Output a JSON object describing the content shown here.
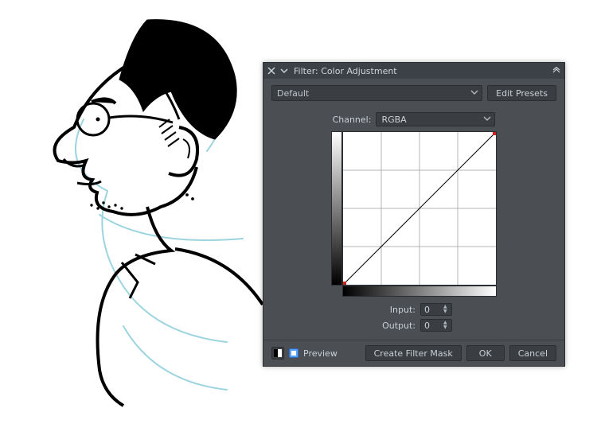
{
  "dialog": {
    "title": "Filter: Color Adjustment",
    "preset": {
      "selected": "Default",
      "edit_label": "Edit Presets"
    },
    "channel": {
      "label": "Channel:",
      "selected": "RGBA"
    },
    "io": {
      "input_label": "Input:",
      "output_label": "Output:",
      "input_value": "0",
      "output_value": "0"
    },
    "footer": {
      "preview_label": "Preview",
      "preview_checked": true,
      "create_mask": "Create Filter Mask",
      "ok": "OK",
      "cancel": "Cancel"
    }
  },
  "chart_data": {
    "type": "line",
    "title": "",
    "xlabel": "Input",
    "ylabel": "Output",
    "xlim": [
      0,
      255
    ],
    "ylim": [
      0,
      255
    ],
    "grid": true,
    "series": [
      {
        "name": "curve",
        "x": [
          0,
          255
        ],
        "y": [
          0,
          255
        ]
      }
    ],
    "handles": [
      {
        "x": 0,
        "y": 0
      },
      {
        "x": 255,
        "y": 255
      }
    ]
  }
}
